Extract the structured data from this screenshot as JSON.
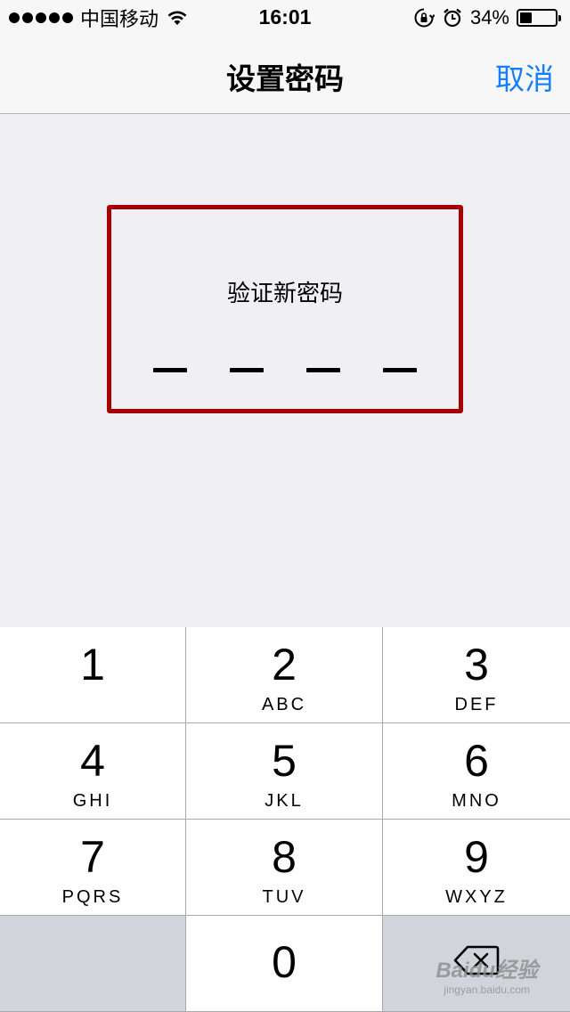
{
  "status_bar": {
    "carrier": "中国移动",
    "time": "16:01",
    "battery_percent_text": "34%",
    "battery_level": 0.34,
    "signal_bars": 5
  },
  "nav": {
    "title": "设置密码",
    "cancel_label": "取消"
  },
  "passcode": {
    "prompt": "验证新密码",
    "slot_count": 4
  },
  "keypad": {
    "keys": [
      {
        "digit": "1",
        "letters": ""
      },
      {
        "digit": "2",
        "letters": "ABC"
      },
      {
        "digit": "3",
        "letters": "DEF"
      },
      {
        "digit": "4",
        "letters": "GHI"
      },
      {
        "digit": "5",
        "letters": "JKL"
      },
      {
        "digit": "6",
        "letters": "MNO"
      },
      {
        "digit": "7",
        "letters": "PQRS"
      },
      {
        "digit": "8",
        "letters": "TUV"
      },
      {
        "digit": "9",
        "letters": "WXYZ"
      },
      {
        "digit": "0",
        "letters": ""
      }
    ]
  },
  "watermark": {
    "brand": "Baidu经验",
    "url": "jingyan.baidu.com"
  },
  "colors": {
    "accent": "#147efb",
    "highlight_border": "#a60000",
    "background": "#efeff4"
  },
  "icons": {
    "wifi": "wifi-icon",
    "rotation_lock": "rotation-lock-icon",
    "alarm": "alarm-icon",
    "battery": "battery-icon",
    "delete": "backspace-icon"
  }
}
